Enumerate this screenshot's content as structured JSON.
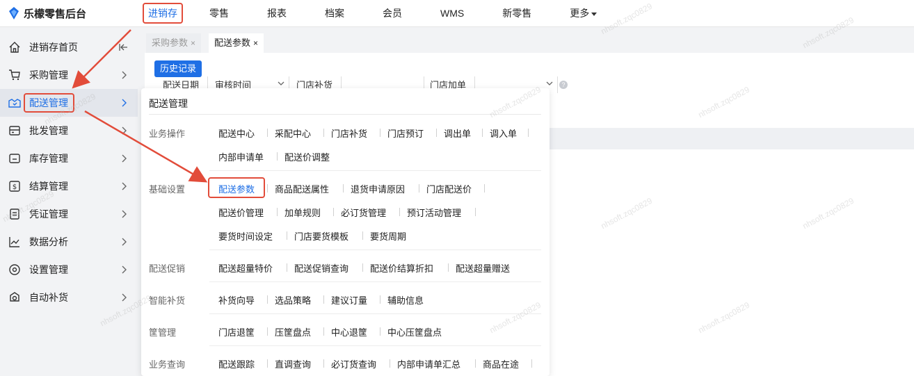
{
  "app": {
    "title": "乐檬零售后台"
  },
  "topnav": [
    {
      "label": "进销存",
      "active": true
    },
    {
      "label": "零售"
    },
    {
      "label": "报表"
    },
    {
      "label": "档案"
    },
    {
      "label": "会员"
    },
    {
      "label": "WMS"
    },
    {
      "label": "新零售"
    },
    {
      "label": "更多"
    }
  ],
  "sidebar": {
    "items": [
      {
        "label": "进销存首页",
        "icon": "home-icon"
      },
      {
        "label": "采购管理",
        "icon": "cart-icon"
      },
      {
        "label": "配送管理",
        "icon": "delivery-icon",
        "active": true
      },
      {
        "label": "批发管理",
        "icon": "wholesale-icon"
      },
      {
        "label": "库存管理",
        "icon": "inventory-icon"
      },
      {
        "label": "结算管理",
        "icon": "dollar-icon"
      },
      {
        "label": "凭证管理",
        "icon": "voucher-icon"
      },
      {
        "label": "数据分析",
        "icon": "chart-icon"
      },
      {
        "label": "设置管理",
        "icon": "gear-icon"
      },
      {
        "label": "自动补货",
        "icon": "replenish-icon"
      }
    ]
  },
  "tabs": [
    {
      "label": "采购参数",
      "close": "×"
    },
    {
      "label": "配送参数",
      "close": "×",
      "active": true
    }
  ],
  "main": {
    "history_button": "历史记录",
    "filters": {
      "date_label": "配送日期",
      "date_value": "审核时间",
      "store_replenish_label": "门店补货",
      "store_add_label": "门店加单"
    },
    "help_icon": "?"
  },
  "panel": {
    "title": "配送管理",
    "sections": [
      {
        "label": "业务操作",
        "links": [
          "配送中心",
          "采配中心",
          "门店补货",
          "门店预订",
          "调出单",
          "调入单",
          "内部申请单",
          "配送价调整"
        ]
      },
      {
        "label": "基础设置",
        "links": [
          "配送参数",
          "商品配送属性",
          "退货申请原因",
          "门店配送价",
          "配送价管理",
          "加单规则",
          "必订货管理",
          "预订活动管理",
          "要货时间设定",
          "门店要货模板",
          "要货周期"
        ]
      },
      {
        "label": "配送促销",
        "links": [
          "配送超量特价",
          "配送促销查询",
          "配送价结算折扣",
          "配送超量赠送"
        ]
      },
      {
        "label": "智能补货",
        "links": [
          "补货向导",
          "选品策略",
          "建议订量",
          "辅助信息"
        ]
      },
      {
        "label": "筐管理",
        "links": [
          "门店退筐",
          "压筐盘点",
          "中心退筐",
          "中心压筐盘点"
        ]
      },
      {
        "label": "业务查询",
        "links": [
          "配送跟踪",
          "直调查询",
          "必订货查询",
          "内部申请单汇总",
          "商品在途"
        ]
      }
    ]
  },
  "watermark": "nhsoft.zqc0829",
  "colors": {
    "accent": "#1f6fe5",
    "highlight": "#e24c3a"
  }
}
